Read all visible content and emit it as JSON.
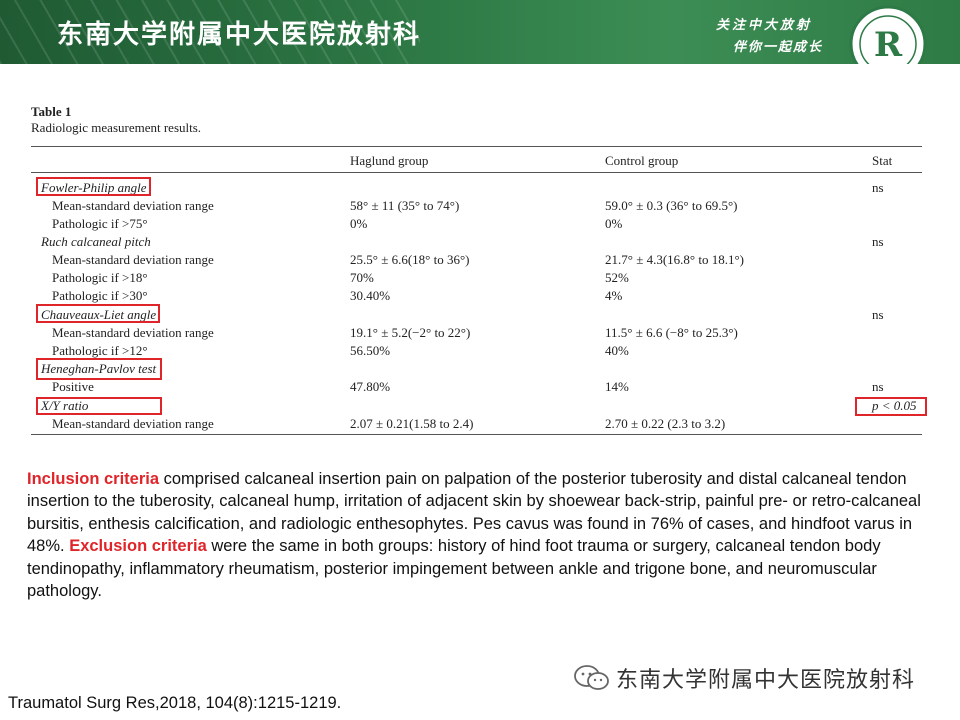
{
  "header": {
    "title": "东南大学附属中大医院放射科",
    "slogan_line1": "关注中大放射",
    "slogan_line2": "伴你一起成长",
    "logo_letter": "R"
  },
  "table": {
    "title": "Table 1",
    "subtitle": "Radiologic measurement results.",
    "columns": [
      "",
      "Haglund group",
      "Control group",
      "Stat"
    ],
    "rows": [
      {
        "label": "Fowler-Philip angle",
        "haglund": "",
        "control": "",
        "stat": "ns"
      },
      {
        "label": "Mean-standard deviation range",
        "haglund": "58° ± 11   (35° to 74°)",
        "control": "59.0° ± 0.3  (36° to 69.5°)",
        "stat": ""
      },
      {
        "label": "Pathologic if >75°",
        "haglund": "0%",
        "control": "0%",
        "stat": ""
      },
      {
        "label": "Ruch calcaneal pitch",
        "haglund": "",
        "control": "",
        "stat": "ns"
      },
      {
        "label": "Mean-standard deviation range",
        "haglund": "25.5° ± 6.6(18° to 36°)",
        "control": "21.7° ± 4.3(16.8° to 18.1°)",
        "stat": ""
      },
      {
        "label": "Pathologic if >18°",
        "haglund": "70%",
        "control": "52%",
        "stat": ""
      },
      {
        "label": "Pathologic if >30°",
        "haglund": "30.40%",
        "control": "4%",
        "stat": ""
      },
      {
        "label": "Chauveaux-Liet angle",
        "haglund": "",
        "control": "",
        "stat": "ns"
      },
      {
        "label": "Mean-standard deviation range",
        "haglund": "19.1° ± 5.2(−2° to 22°)",
        "control": "11.5° ± 6.6  (−8° to 25.3°)",
        "stat": ""
      },
      {
        "label": "Pathologic if >12°",
        "haglund": "56.50%",
        "control": "40%",
        "stat": ""
      },
      {
        "label": "Heneghan-Pavlov test",
        "haglund": "",
        "control": "",
        "stat": ""
      },
      {
        "label": "Positive",
        "haglund": "47.80%",
        "control": "14%",
        "stat": "ns"
      },
      {
        "label": "X/Y ratio",
        "haglund": "",
        "control": "",
        "stat": "p < 0.05"
      },
      {
        "label": "Mean-standard deviation range",
        "haglund": "2.07 ± 0.21(1.58 to 2.4)",
        "control": "2.70 ± 0.22   (2.3 to 3.2)",
        "stat": ""
      }
    ]
  },
  "paragraph": {
    "inclusion_label": "Inclusion criteria",
    "inclusion_text": " comprised calcaneal insertion pain on palpation of the posterior tuberosity and distal calcaneal tendon insertion to the tuberosity, calcaneal hump, irritation of adjacent skin by shoewear back-strip, painful pre- or retro-calcaneal bursitis, enthesis calcification, and radiologic enthesophytes. Pes cavus was found in 76% of cases, and hindfoot varus in 48%. ",
    "exclusion_label": "Exclusion criteria",
    "exclusion_text": " were the same in both groups: history of hind foot trauma or surgery, calcaneal tendon body tendinopathy, inflammatory rheumatism, posterior impingement between ankle and trigone bone, and neuromuscular pathology."
  },
  "footer": {
    "brand": "东南大学附属中大医院放射科",
    "citation": "Traumatol Surg Res,2018, 104(8):1215-1219."
  },
  "colors": {
    "header_green": "#2e7a46",
    "highlight_red": "#e0252a"
  }
}
